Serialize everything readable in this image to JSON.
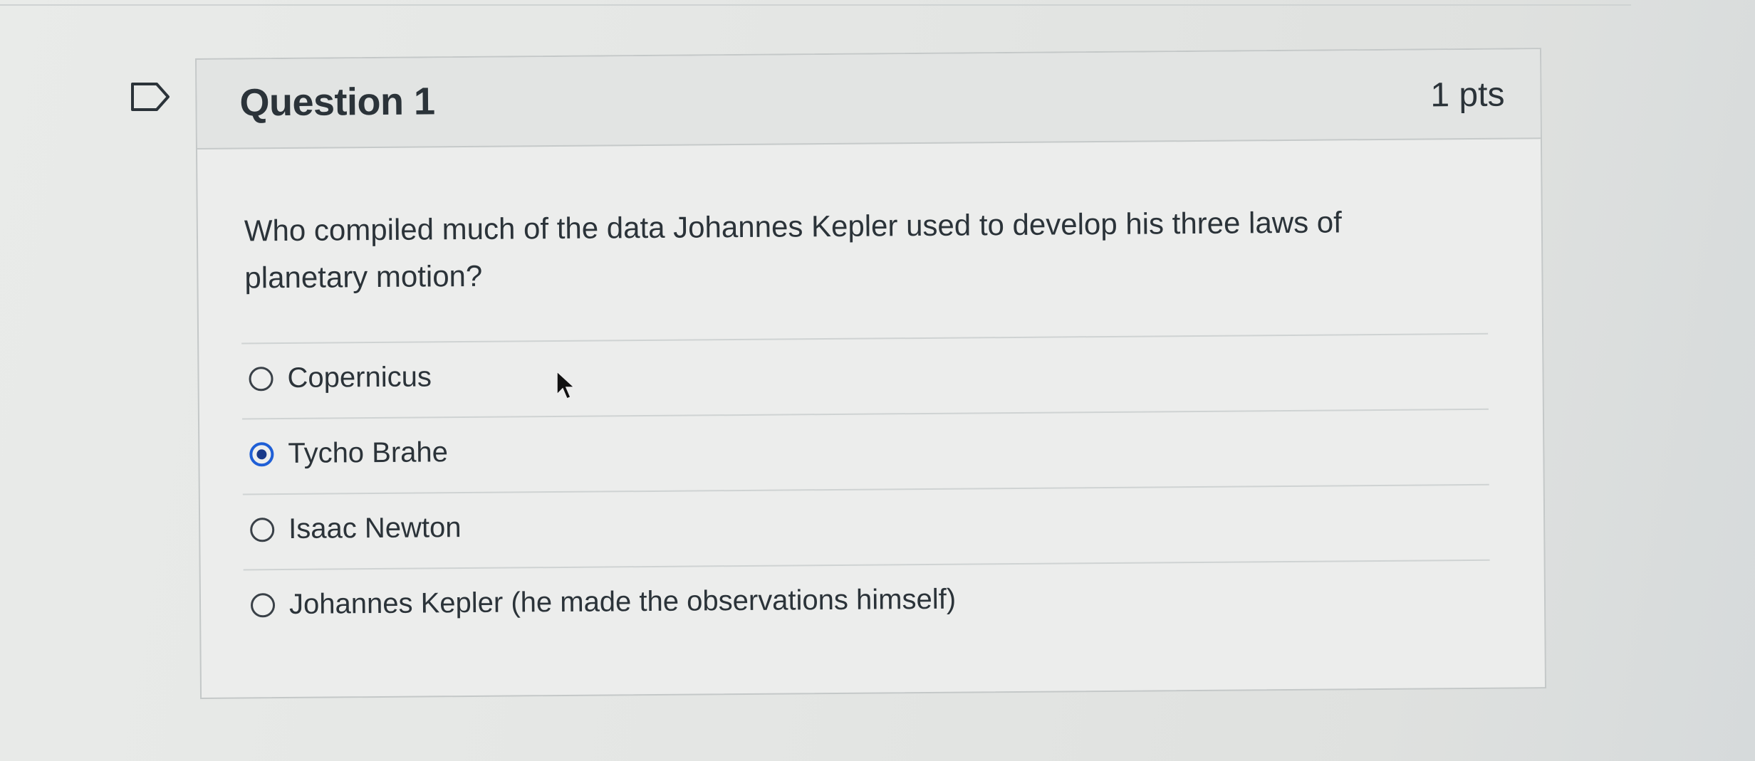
{
  "question": {
    "title": "Question 1",
    "points": "1 pts",
    "text": "Who compiled much of the data Johannes Kepler used to develop his three laws of planetary motion?"
  },
  "answers": [
    {
      "label": "Copernicus",
      "selected": false
    },
    {
      "label": "Tycho Brahe",
      "selected": true
    },
    {
      "label": "Isaac Newton",
      "selected": false
    },
    {
      "label": "Johannes Kepler (he made the observations himself)",
      "selected": false
    }
  ],
  "colors": {
    "selected_radio": "#1f5fd6",
    "text": "#2b3339"
  },
  "icons": {
    "flag": "flag-question-icon",
    "cursor": "mouse-pointer-icon"
  }
}
